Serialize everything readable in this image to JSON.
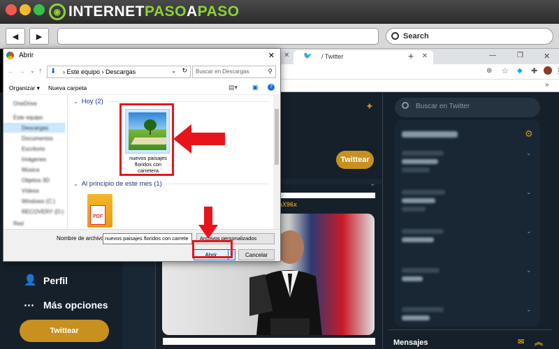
{
  "brand": {
    "part1": "INTERNET",
    "part2": "PASO",
    "part3": "A",
    "part4": "PASO"
  },
  "outer_nav": {
    "search_label": "Search"
  },
  "chrome": {
    "tab_label": "/ Twitter",
    "new_tab": "+"
  },
  "twitter": {
    "tweet_button_feed": "Twittear",
    "left_menu": [
      {
        "label": "Perfil"
      },
      {
        "label": "Más opciones"
      }
    ],
    "tweet_button_side": "Twittear",
    "search_placeholder": "Buscar en Twitter",
    "messages_label": "Mensajes",
    "link_fragment": "aX96x"
  },
  "dialog": {
    "title": "Abrir",
    "path": [
      "Este equipo",
      "Descargas"
    ],
    "search_placeholder": "Buscar en Descargas",
    "toolbar": {
      "organize": "Organizar ▾",
      "new_folder": "Nueva carpeta"
    },
    "nav_items": [
      "OneDrive",
      "Este equipo",
      "Descargas",
      "Documentos",
      "Escritorio",
      "Imágenes",
      "Música",
      "Objetos 3D",
      "Vídeos",
      "Windows (C:)",
      "RECOVERY (D:)",
      "Red"
    ],
    "group_today": "Hoy (2)",
    "group_month": "Al principio de este mes (1)",
    "file_caption": "nuevos paisajes floridos con carretera",
    "filename_label": "Nombre de archivo:",
    "filename_value": "nuevos paisajes floridos con carrete",
    "filetype_value": "Archivos personalizados",
    "open_button": "Abrir",
    "cancel_button": "Cancelar"
  },
  "colors": {
    "accent_red": "#e8141c",
    "twitter_bg": "#15202b",
    "tweet_btn": "#c8901f",
    "brand_green": "#8bd13b"
  }
}
